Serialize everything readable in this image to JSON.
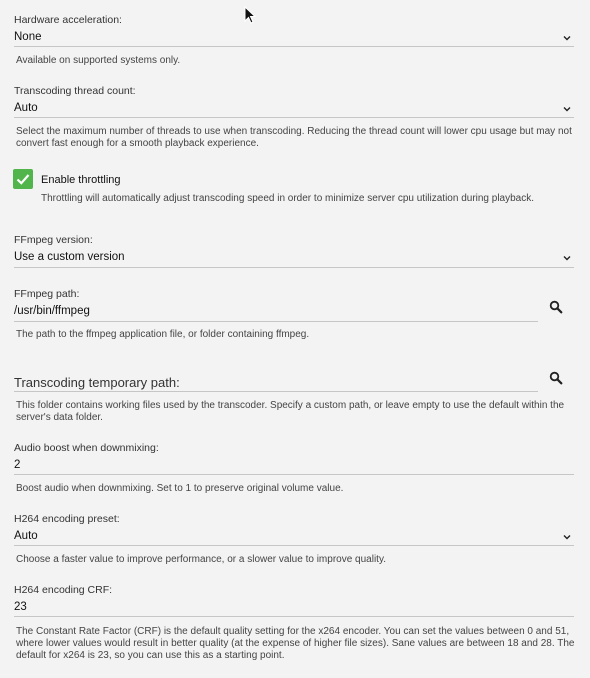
{
  "hardware_acceleration": {
    "label": "Hardware acceleration:",
    "value": "None",
    "help": "Available on supported systems only."
  },
  "thread_count": {
    "label": "Transcoding thread count:",
    "value": "Auto",
    "help": "Select the maximum number of threads to use when transcoding. Reducing the thread count will lower cpu usage but may not convert fast enough for a smooth playback experience."
  },
  "throttling": {
    "label": "Enable throttling",
    "checked": true,
    "help": "Throttling will automatically adjust transcoding speed in order to minimize server cpu utilization during playback."
  },
  "ffmpeg_version": {
    "label": "FFmpeg version:",
    "value": "Use a custom version"
  },
  "ffmpeg_path": {
    "label": "FFmpeg path:",
    "value": "/usr/bin/ffmpeg",
    "help": "The path to the ffmpeg application file, or folder containing ffmpeg."
  },
  "temp_path": {
    "placeholder": "Transcoding temporary path:",
    "help": "This folder contains working files used by the transcoder. Specify a custom path, or leave empty to use the default within the server's data folder."
  },
  "audio_boost": {
    "label": "Audio boost when downmixing:",
    "value": "2",
    "help": "Boost audio when downmixing. Set to 1 to preserve original volume value."
  },
  "h264_preset": {
    "label": "H264 encoding preset:",
    "value": "Auto",
    "help": "Choose a faster value to improve performance, or a slower value to improve quality."
  },
  "h264_crf": {
    "label": "H264 encoding CRF:",
    "value": "23",
    "help": "The Constant Rate Factor (CRF) is the default quality setting for the x264 encoder. You can set the values between 0 and 51, where lower values would result in better quality (at the expense of higher file sizes). Sane values are between 18 and 28. The default for x264 is 23, so you can use this as a starting point."
  },
  "colors": {
    "background": "#f3f3f3",
    "checkbox_accent": "#52b54b",
    "underline": "#c6c6c6"
  },
  "icons": {
    "dropdown": "chevron-down-icon",
    "search": "search-icon",
    "check": "check-icon",
    "cursor": "mouse-pointer-icon"
  }
}
